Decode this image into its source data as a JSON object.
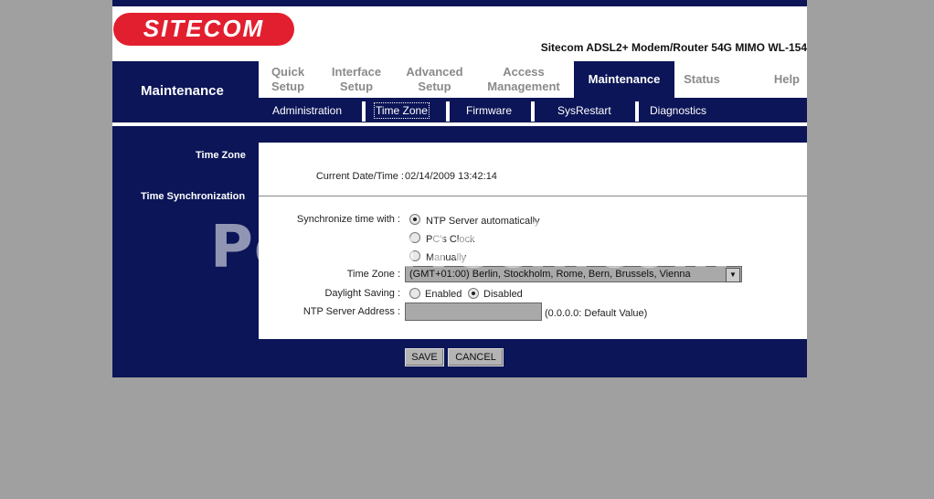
{
  "brand": {
    "logo_text": "SITECOM",
    "logo_color": "#e21f2f",
    "product": "Sitecom ADSL2+ Modem/Router 54G MIMO WL-154"
  },
  "colors": {
    "nav": "#0b1557",
    "page_bg": "#a0a0a0"
  },
  "section_title": "Maintenance",
  "tabs": [
    {
      "line1": "Quick",
      "line2": "Setup"
    },
    {
      "line1": "Interface",
      "line2": "Setup"
    },
    {
      "line1": "Advanced",
      "line2": "Setup"
    },
    {
      "line1": "Access",
      "line2": "Management"
    },
    {
      "line1": "Maintenance",
      "line2": ""
    },
    {
      "line1": "Status",
      "line2": ""
    },
    {
      "line1": "Help",
      "line2": ""
    }
  ],
  "subtabs": [
    "Administration",
    "Time Zone",
    "Firmware",
    "SysRestart",
    "Diagnostics"
  ],
  "side": {
    "time_zone": "Time Zone",
    "time_sync": "Time Synchronization"
  },
  "form": {
    "current_label": "Current Date/Time :",
    "current_value": "02/14/2009 13:42:14",
    "sync_label": "Synchronize time with :",
    "sync_options": [
      "NTP Server automatically",
      "PC's Clock",
      "Manually"
    ],
    "timezone_label": "Time Zone :",
    "timezone_value": "(GMT+01:00) Berlin, Stockholm, Rome, Bern, Brussels, Vienna",
    "dst_label": "Daylight Saving :",
    "dst_options": [
      "Enabled",
      "Disabled"
    ],
    "ntp_label": "NTP Server Address :",
    "ntp_hint": "(0.0.0.0: Default Value)"
  },
  "buttons": {
    "save": "SAVE",
    "cancel": "CANCEL"
  },
  "watermark": "PcWinTech.com"
}
